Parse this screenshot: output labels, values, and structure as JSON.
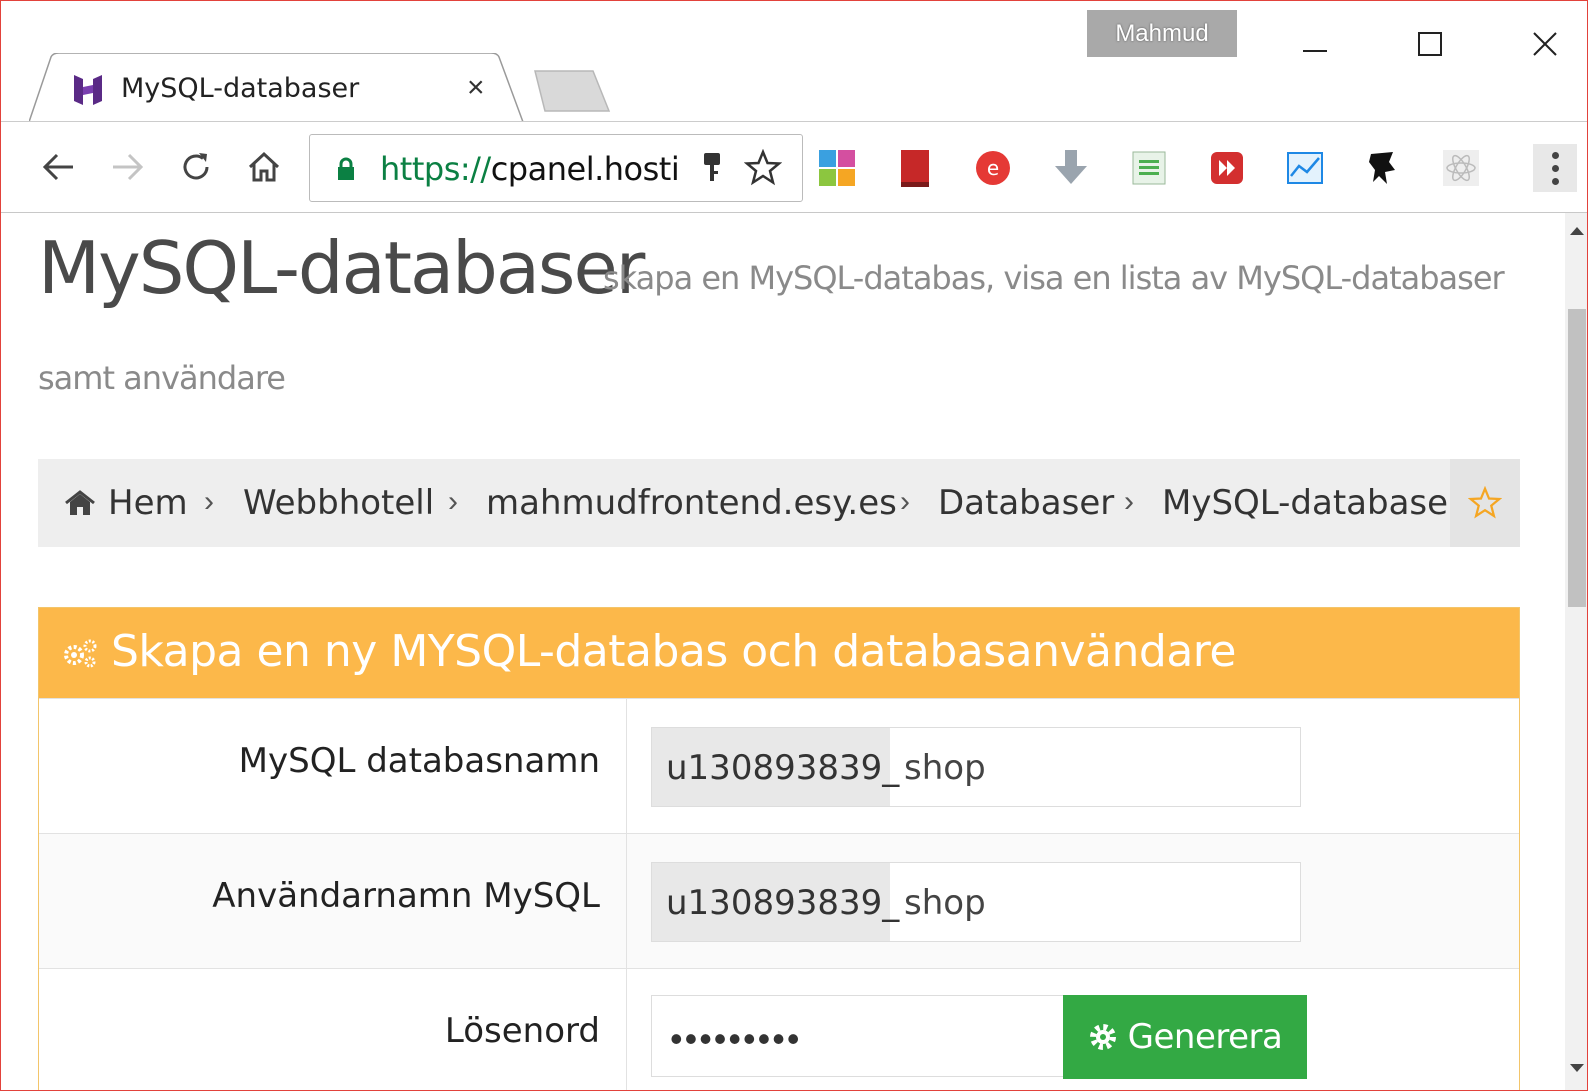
{
  "window": {
    "profile_name": "Mahmud",
    "tab": {
      "title": "MySQL-databaser",
      "close": "×"
    },
    "address": {
      "scheme": "https://",
      "host": "cpanel.hosti"
    },
    "extensions": [
      "colorzilla-icon",
      "book-icon",
      "pocket-icon",
      "download-icon",
      "spreadsheet-icon",
      "media-icon",
      "chart-icon",
      "ninja-icon",
      "react-icon"
    ]
  },
  "page": {
    "title": "MySQL-databaser",
    "subtitle_line1": "skapa en MySQL-databas, visa en lista av MySQL-databaser",
    "subtitle_line2": "samt användare"
  },
  "breadcrumb": {
    "items": [
      "Hem",
      "Webbhotell",
      "mahmudfrontend.esy.es",
      "Databaser",
      "MySQL-databaser"
    ],
    "separator": "›"
  },
  "panel": {
    "title": "Skapa en ny MYSQL-databas och databasanvändare",
    "accent": "#fcb84a",
    "rows": [
      {
        "label": "MySQL databasnamn",
        "prefix": "u130893839_",
        "value": "shop"
      },
      {
        "label": "Användarnamn MySQL",
        "prefix": "u130893839_",
        "value": "shop"
      },
      {
        "label": "Lösenord",
        "value": "•••••••••",
        "button": "Generera"
      }
    ]
  }
}
